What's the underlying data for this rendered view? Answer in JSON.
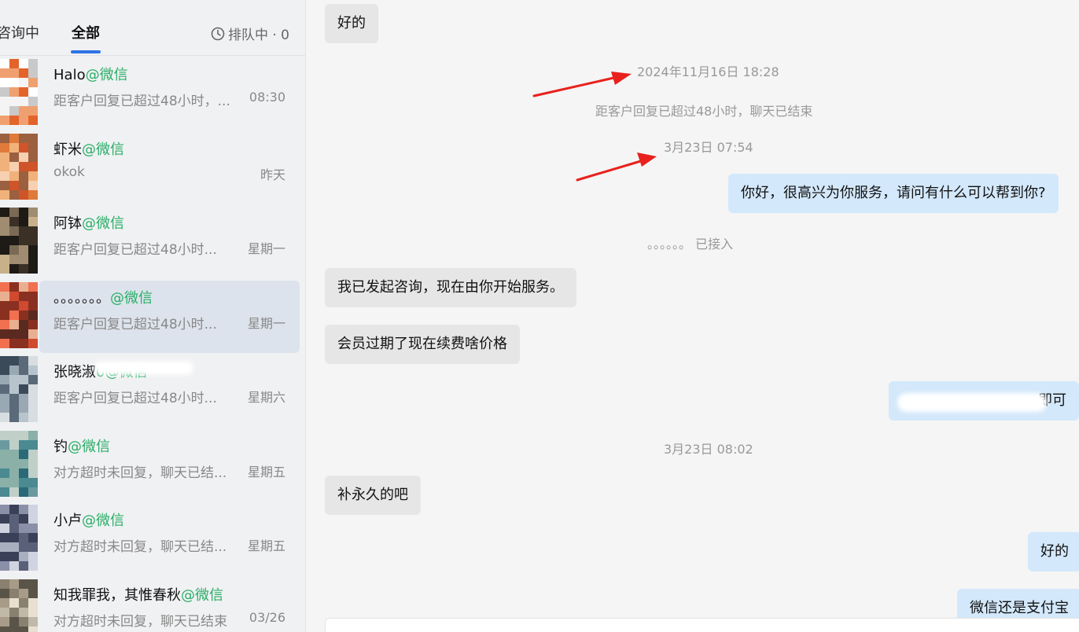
{
  "tabs": {
    "consulting": "咨询中",
    "all": "全部",
    "queue": "排队中 · 0"
  },
  "conversations": [
    {
      "name": "Halo",
      "channel": "@微信",
      "preview": "距客户回复已超过48小时，...",
      "time": "08:30"
    },
    {
      "name": "虾米",
      "channel": "@微信",
      "preview": "okok",
      "time": "昨天"
    },
    {
      "name": "阿钵",
      "channel": "@微信",
      "preview": "距客户回复已超过48小时...",
      "time": "星期一"
    },
    {
      "name": "。。。。。。。",
      "channel": "@微信",
      "preview": "距客户回复已超过48小时...",
      "time": "星期一"
    },
    {
      "name": "张晓淑",
      "channel": "0@微信",
      "preview": "距客户回复已超过48小时...",
      "time": "星期六"
    },
    {
      "name": "钓",
      "channel": "@微信",
      "preview": "对方超时未回复，聊天已结...",
      "time": "星期五"
    },
    {
      "name": "小卢",
      "channel": "@微信",
      "preview": "对方超时未回复，聊天已结...",
      "time": "星期五"
    },
    {
      "name": "知我罪我，其惟春秋",
      "channel": "@微信",
      "preview": "对方超时未回复，聊天已结束",
      "time": "03/26"
    }
  ],
  "chat": {
    "msg_ok_top": "好的",
    "ts1": "2024年11月16日 18:28",
    "sys_ended": "距客户回复已超过48小时，聊天已结束",
    "ts2": "3月23日 07:54",
    "msg_greeting": "你好，很高兴为你服务，请问有什么可以帮到你?",
    "sys_joined": "。。。。。。 已接入",
    "msg_consult": "我已发起咨询，现在由你开始服务。",
    "msg_renew": "会员过期了现在续费啥价格",
    "msg_redacted_suffix": "即可",
    "ts3": "3月23日 08:02",
    "msg_permanent": "补永久的吧",
    "msg_ok": "好的",
    "msg_pay": "微信还是支付宝"
  },
  "colors": {
    "accent": "#2d73e6",
    "channel_green": "#2aae67",
    "incoming_bubble": "#e6e6e7",
    "outgoing_bubble": "#d3e8fb",
    "arrow_red": "#e8211c"
  }
}
